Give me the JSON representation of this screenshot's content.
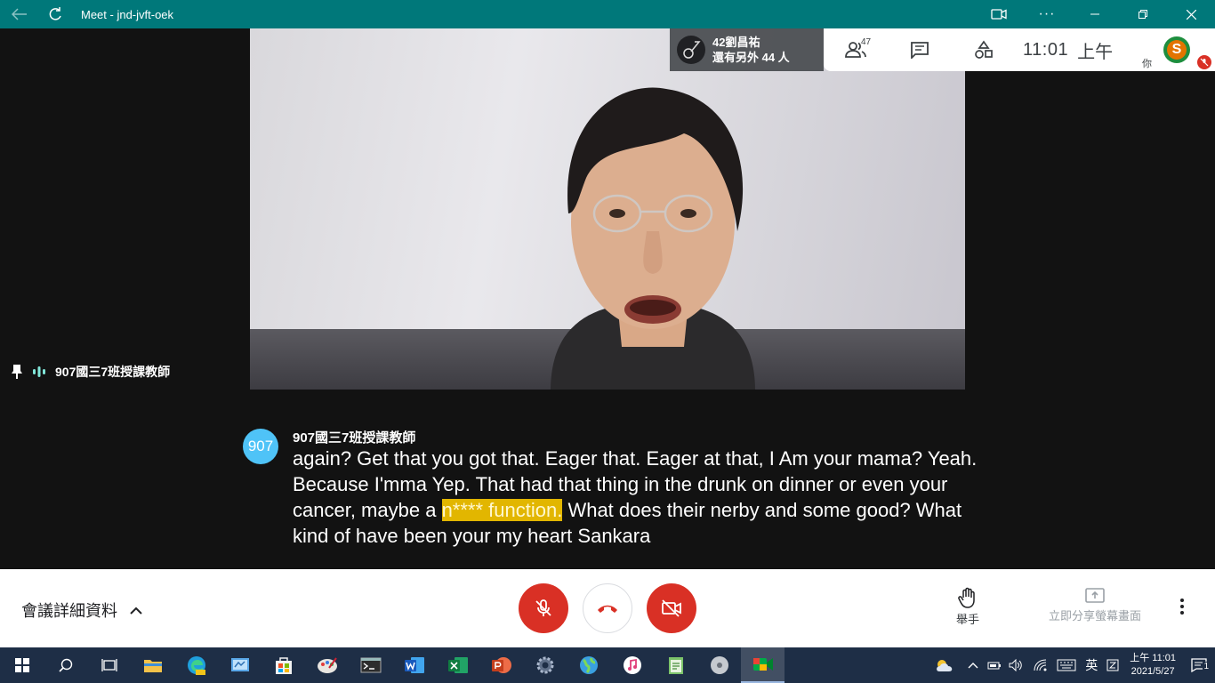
{
  "window": {
    "title": "Meet - jnd-jvft-oek"
  },
  "presenter": {
    "name": "42劉昌祐",
    "others": "還有另外 44 人"
  },
  "toppanel": {
    "people_count": "47",
    "time": "11:01",
    "ampm": "上午",
    "you": "你"
  },
  "speaker": {
    "label": "907國三7班授課教師"
  },
  "caption": {
    "badge": "907",
    "name": "907國三7班授課教師",
    "text_before": "again? Get that you got that. Eager that. Eager at that, I Am your mama? Yeah. Because I'mma Yep. That had that thing in the drunk on dinner or even your cancer, maybe a",
    "highlight": "n**** function.",
    "text_after": " What does their nerby and some good? What kind of have been your my heart Sankara"
  },
  "bottom": {
    "details": "會議詳細資料",
    "raise_hand": "舉手",
    "share": "立即分享螢幕畫面"
  },
  "taskbar": {
    "ime": "英",
    "time": "上午 11:01",
    "date": "2021/5/27",
    "notification_count": "1",
    "apps": [
      "start",
      "search",
      "task-view",
      "file-explorer",
      "edge",
      "control-panel",
      "store",
      "paint",
      "terminal",
      "word",
      "excel",
      "powerpoint",
      "settings",
      "globe",
      "itunes",
      "notepad",
      "media",
      "meet"
    ]
  },
  "colors": {
    "titlebar": "#00787a",
    "stage": "#121212",
    "hangup_red": "#d93025",
    "caption_badge": "#4fc3f7",
    "highlight": "#e2b600",
    "taskbar": "#1e2e46"
  }
}
